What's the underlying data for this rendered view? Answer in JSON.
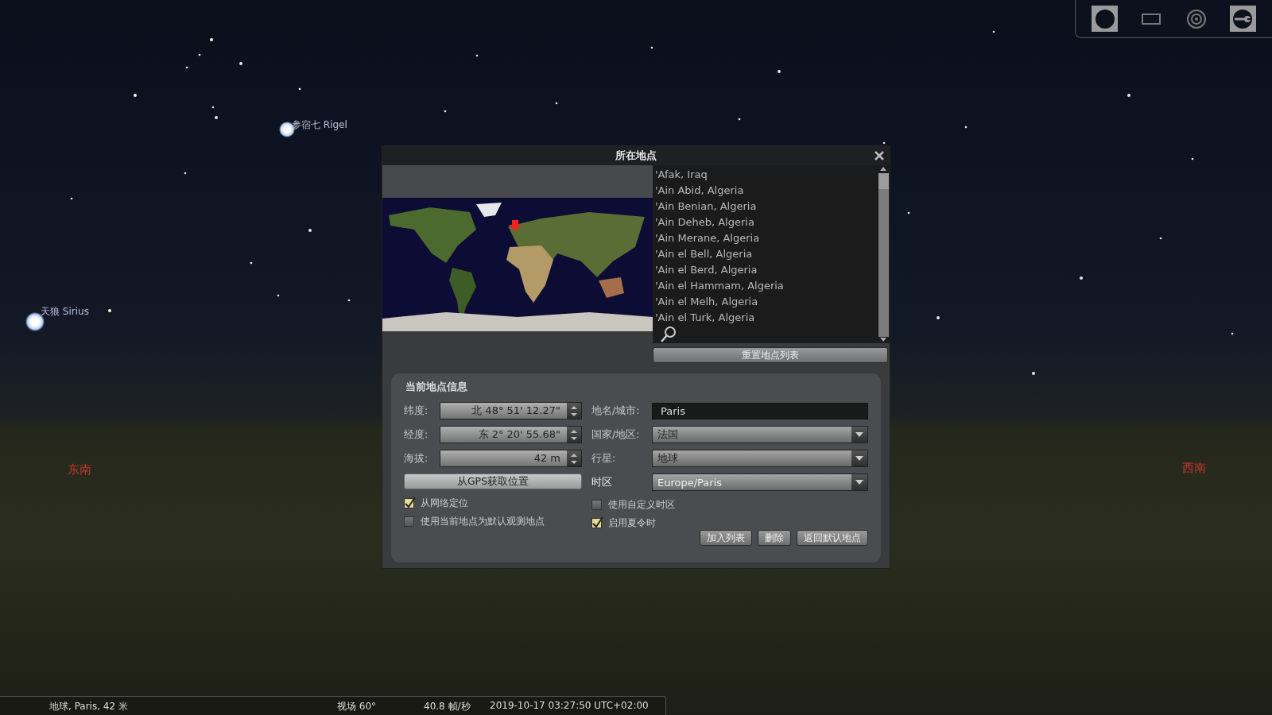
{
  "sky": {
    "stars": [
      {
        "name": "参宿七 Rigel"
      },
      {
        "name": "天狼 Sirius"
      }
    ],
    "compass": [
      {
        "label": "东南"
      },
      {
        "label": "西南"
      }
    ]
  },
  "toolbar": {
    "buttons": [
      {
        "kind": "disc",
        "on": true
      },
      {
        "kind": "frame",
        "on": false
      },
      {
        "kind": "target",
        "on": false
      },
      {
        "kind": "wrench",
        "on": true
      }
    ]
  },
  "dialog": {
    "title": "所在地点",
    "locations": [
      "'Afak, Iraq",
      "'Ain Abid, Algeria",
      "'Ain Benian, Algeria",
      "'Ain Deheb, Algeria",
      "'Ain Merane, Algeria",
      "'Ain el Bell, Algeria",
      "'Ain el Berd, Algeria",
      "'Ain el Hammam, Algeria",
      "'Ain el Melh, Algeria",
      "'Ain el Turk, Algeria"
    ],
    "reset_button": "重置地点列表",
    "info": {
      "heading": "当前地点信息",
      "latitude": {
        "label": "纬度:",
        "value": "北 48° 51' 12.27\""
      },
      "longitude": {
        "label": "经度:",
        "value": "东 2° 20' 55.68\""
      },
      "altitude": {
        "label": "海拔:",
        "value": "42 m"
      },
      "gps_button": "从GPS获取位置",
      "left_checks": [
        {
          "label": "从网络定位",
          "checked": true
        },
        {
          "label": "使用当前地点为默认观测地点",
          "checked": false
        }
      ],
      "name": {
        "label": "地名/城市:",
        "value": "Paris"
      },
      "country": {
        "label": "国家/地区:",
        "value": "法国"
      },
      "planet": {
        "label": "行星:",
        "value": "地球"
      },
      "timezone": {
        "label": "时区",
        "value": "Europe/Paris"
      },
      "right_checks": [
        {
          "label": "使用自定义时区",
          "checked": false
        },
        {
          "label": "启用夏令时",
          "checked": true
        }
      ],
      "buttons": [
        "加入列表",
        "删除",
        "返回默认地点"
      ]
    }
  },
  "status_bar": {
    "location": "地球, Paris, 42 米",
    "fov": "视场 60°",
    "fps": "40.8 帧/秒",
    "datetime": "2019-10-17 03:27:50 UTC+02:00"
  }
}
